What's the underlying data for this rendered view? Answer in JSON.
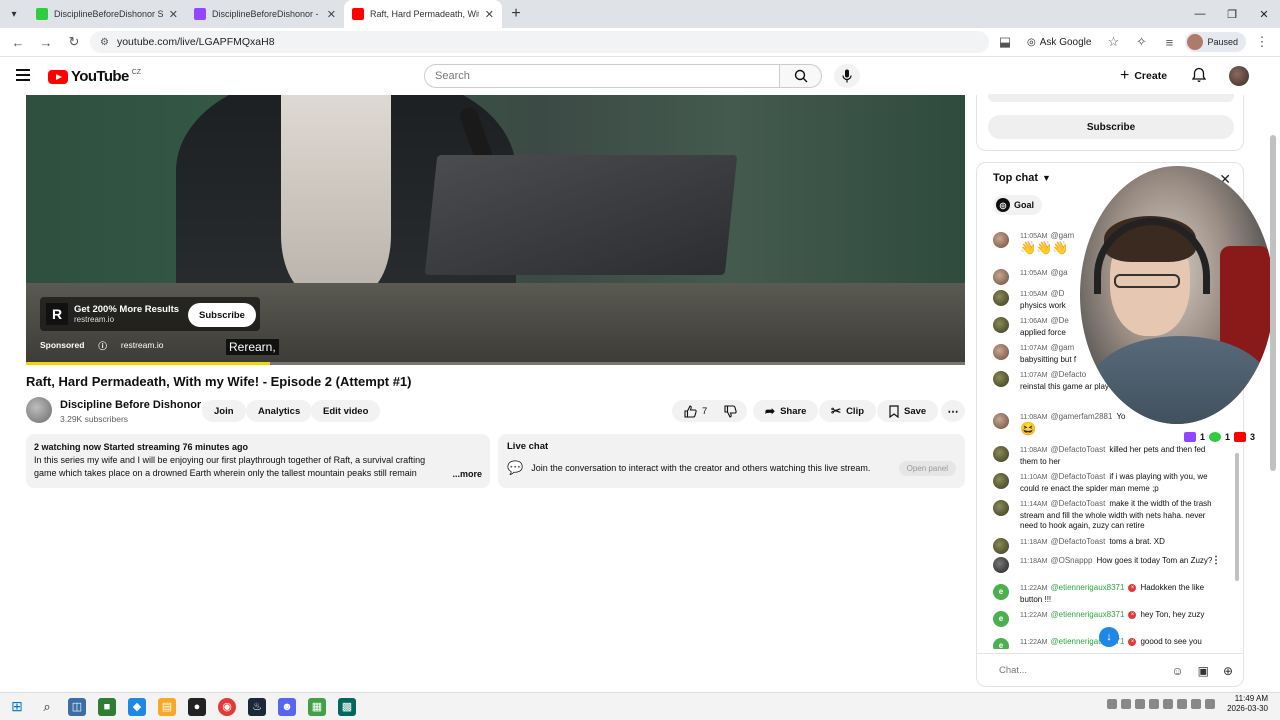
{
  "browser": {
    "tabs": [
      {
        "title": "DisciplineBeforeDishonor Strea",
        "favicon_color": "#2ecc40"
      },
      {
        "title": "DisciplineBeforeDishonor - Twi",
        "favicon_color": "#9146ff"
      },
      {
        "title": "Raft, Hard Permadeath, With m",
        "favicon_color": "#ff0000"
      }
    ],
    "url": "youtube.com/live/LGAPFMQxaH8",
    "ask_google": "Ask Google",
    "profile_status": "Paused"
  },
  "header": {
    "logo_text": "YouTube",
    "country": "CZ",
    "search_placeholder": "Search",
    "create_label": "Create"
  },
  "player": {
    "ad": {
      "logo_letter": "R",
      "title": "Get 200% More Results",
      "domain": "restream.io",
      "subscribe_label": "Subscribe",
      "sponsored_label": "Sponsored",
      "site": "restream.io"
    },
    "caption": "Ream,",
    "caption_full": "Rerearn,",
    "progress_fraction": 0.26
  },
  "video": {
    "title": "Raft, Hard Permadeath, With my Wife! - Episode 2 (Attempt #1)",
    "channel_name": "Discipline Before Dishonor",
    "subscribers": "3.29K subscribers",
    "join_label": "Join",
    "analytics_label": "Analytics",
    "edit_label": "Edit video",
    "like_count": "7",
    "share_label": "Share",
    "clip_label": "Clip",
    "save_label": "Save"
  },
  "description": {
    "meta": "2 watching now  Started streaming 76 minutes ago",
    "body": "In this series my wife and I will be enjoying our first playthrough together of Raft, a survival crafting game which takes place on a drowned Earth wherein only the tallest mountain peaks still remain above wa",
    "more_label": "...more"
  },
  "live_chat_panel": {
    "title": "Live chat",
    "text": "Join the conversation to interact with the creator and others watching this live stream.",
    "open_label": "Open panel"
  },
  "sidebar": {
    "subscribe_label": "Subscribe"
  },
  "chat": {
    "mode": "Top chat",
    "goal_label": "Goal",
    "input_placeholder": "Chat...",
    "messages": [
      {
        "time": "11:05AM",
        "author": "@gam",
        "text": "",
        "emoji": "👋👋👋"
      },
      {
        "time": "11:05AM",
        "author": "@ga",
        "text": ""
      },
      {
        "time": "11:05AM",
        "author": "@D",
        "text": "physics work"
      },
      {
        "time": "11:06AM",
        "author": "@De",
        "text": "applied force"
      },
      {
        "time": "11:07AM",
        "author": "@gam",
        "text": "babysitting but f"
      },
      {
        "time": "11:07AM",
        "author": "@Defacto",
        "text": "reinstal this game ar play it with you"
      },
      {
        "time": "11:08AM",
        "author": "@gamerfam2881",
        "text": "Yo",
        "emoji": "😆"
      },
      {
        "time": "11:08AM",
        "author": "@DefactoToast",
        "text": "killed her pets and then fed them to her"
      },
      {
        "time": "11:10AM",
        "author": "@DefactoToast",
        "text": "if i was playing with you, we could re enact the spider man meme ;p"
      },
      {
        "time": "11:14AM",
        "author": "@DefactoToast",
        "text": "make it the width of the trash stream and fill the whole width with nets haha. never need to hook again, zuzy can retire"
      },
      {
        "time": "11:18AM",
        "author": "@DefactoToast",
        "text": "toms a brat. XD"
      },
      {
        "time": "11:18AM",
        "author": "@OSnappp",
        "text": "How goes it today Tom an Zuzy?"
      },
      {
        "time": "11:22AM",
        "author": "@etiennerigaux8371",
        "text": "Hadokken the like button !!!"
      },
      {
        "time": "11:22AM",
        "author": "@etiennerigaux8371",
        "text": "hey Ton, hey zuzy"
      },
      {
        "time": "11:22AM",
        "author": "@etiennerigaux8371",
        "text": "goood to see you"
      }
    ]
  },
  "viewer_counts": [
    {
      "platform": "twitch",
      "count": "1",
      "color": "#9146ff"
    },
    {
      "platform": "kick",
      "count": "1",
      "color": "#2ecc40"
    },
    {
      "platform": "youtube",
      "count": "3",
      "color": "#ff0000"
    }
  ],
  "taskbar": {
    "time": "11:49 AM",
    "date": "2026-03-30"
  }
}
